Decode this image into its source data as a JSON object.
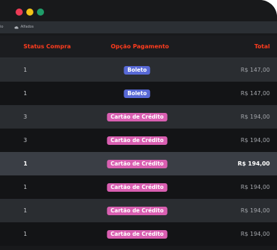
{
  "window": {
    "controls": {
      "close_color": "#ec3b56",
      "minimize_color": "#f2c318",
      "maximize_color": "#1f9d6a"
    }
  },
  "bookmarks_bar": {
    "left_text": "rio",
    "item_label": "Alfados",
    "item_icon": "cloud-icon"
  },
  "table": {
    "columns": {
      "status": "Status Compra",
      "payment": "Opção Pagamento",
      "total": "Total"
    },
    "header_color": "#ff3c1e",
    "payment_colors": {
      "Boleto": "#5869d6",
      "Cartão de Crédito": "#d95fb1"
    },
    "rows": [
      {
        "status": "1",
        "payment": "Boleto",
        "total": "R$ 147,00",
        "shade": "light"
      },
      {
        "status": "1",
        "payment": "Boleto",
        "total": "R$ 147,00",
        "shade": "dark"
      },
      {
        "status": "3",
        "payment": "Cartão de Crédito",
        "total": "R$ 194,00",
        "shade": "light"
      },
      {
        "status": "3",
        "payment": "Cartão de Crédito",
        "total": "R$ 194,00",
        "shade": "dark"
      },
      {
        "status": "1",
        "payment": "Cartão de Crédito",
        "total": "R$ 194,00",
        "shade": "sel"
      },
      {
        "status": "1",
        "payment": "Cartão de Crédito",
        "total": "R$ 194,00",
        "shade": "dark"
      },
      {
        "status": "1",
        "payment": "Cartão de Crédito",
        "total": "R$ 194,00",
        "shade": "light"
      },
      {
        "status": "1",
        "payment": "Cartão de Crédito",
        "total": "R$ 194,00",
        "shade": "dark"
      }
    ]
  }
}
